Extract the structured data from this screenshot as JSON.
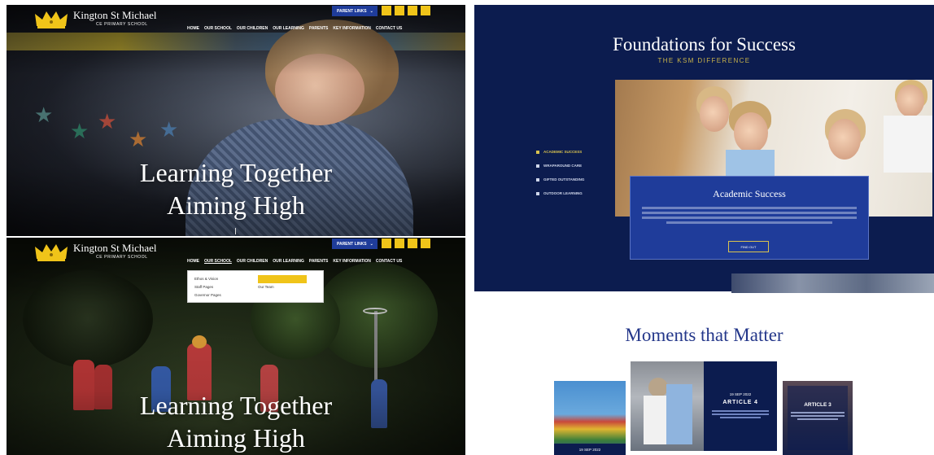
{
  "school": {
    "name": "Kington St Michael",
    "subtitle": "CE PRIMARY SCHOOL"
  },
  "header": {
    "parent_links_label": "PARENT LINKS",
    "nav": [
      "HOME",
      "OUR SCHOOL",
      "OUR CHILDREN",
      "OUR LEARNING",
      "PARENTS",
      "KEY INFORMATION",
      "CONTACT US"
    ]
  },
  "hero": {
    "line1": "Learning Together",
    "line2": "Aiming High"
  },
  "dropdown": {
    "col1": [
      "Ethos & Vision",
      "Staff Pages",
      "Governor Pages"
    ],
    "col2_highlight": "",
    "col2": [
      "Our Team"
    ]
  },
  "foundations": {
    "title": "Foundations for Success",
    "subtitle": "THE KSM DIFFERENCE",
    "menu": [
      "ACADEMIC SUCCESS",
      "WRAPAROUND CARE",
      "GIFTED OUTSTANDING",
      "OUTDOOR LEARNING"
    ],
    "card_title": "Academic Success",
    "card_text": "",
    "card_button": "FIND OUT"
  },
  "moments": {
    "title": "Moments that Matter",
    "articles": [
      {
        "date": "19 SEP 2022"
      },
      {
        "date": "19 SEP 2022",
        "title": "ARTICLE 4",
        "desc": ""
      },
      {
        "date": "",
        "title": "ARTICLE 3",
        "desc": ""
      }
    ]
  },
  "colors": {
    "navy": "#0c1c4f",
    "royal": "#1f3c9a",
    "gold": "#f0c419",
    "gold_text": "#c9b34a"
  }
}
